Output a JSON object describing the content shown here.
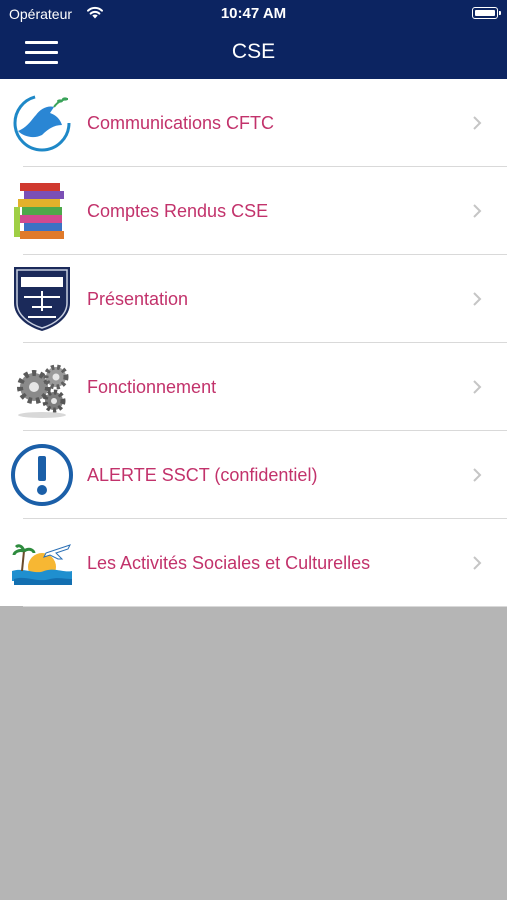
{
  "status_bar": {
    "carrier": "Opérateur",
    "time": "10:47 AM"
  },
  "nav": {
    "title": "CSE",
    "menu_icon": "hamburger-menu-icon"
  },
  "menu": [
    {
      "label": "Communications CFTC",
      "icon": "dove-icon"
    },
    {
      "label": "Comptes Rendus CSE",
      "icon": "book-stack-icon"
    },
    {
      "label": "Présentation",
      "icon": "airbus-shield-icon"
    },
    {
      "label": "Fonctionnement",
      "icon": "gears-icon"
    },
    {
      "label": "ALERTE SSCT (confidentiel)",
      "icon": "exclamation-icon"
    },
    {
      "label": "Les Activités Sociales et Culturelles",
      "icon": "beach-plane-icon"
    }
  ],
  "colors": {
    "nav_bar": "#0c2461",
    "label_text": "#c2326b",
    "background": "#b5b5b5"
  }
}
